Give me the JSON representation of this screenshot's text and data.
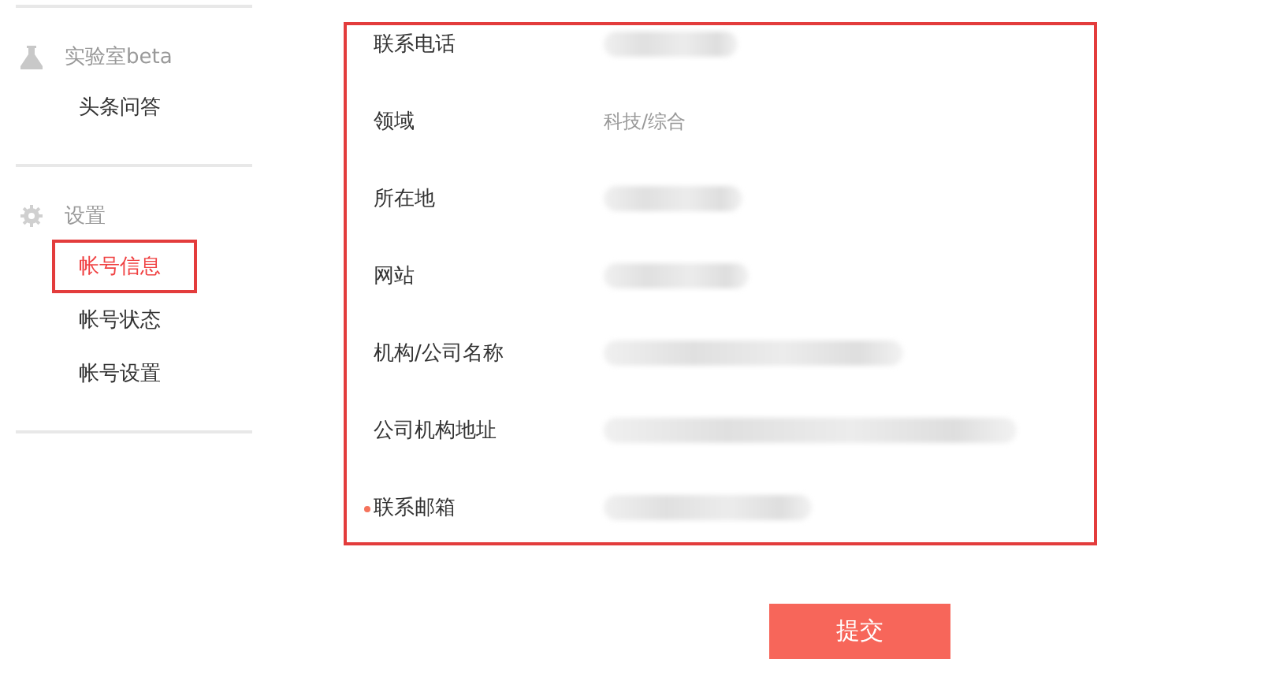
{
  "sidebar": {
    "sections": [
      {
        "kind": "lab",
        "title": "实验室beta",
        "items": [
          {
            "label": "头条问答",
            "selected": false,
            "highlighted": false
          }
        ]
      },
      {
        "kind": "settings",
        "title": "设置",
        "items": [
          {
            "label": "帐号信息",
            "selected": true,
            "highlighted": true
          },
          {
            "label": "帐号状态",
            "selected": false,
            "highlighted": false
          },
          {
            "label": "帐号设置",
            "selected": false,
            "highlighted": false
          }
        ]
      }
    ]
  },
  "form": {
    "highlighted": true,
    "fields": [
      {
        "label": "联系电话",
        "required": false,
        "redacted": true
      },
      {
        "label": "领域",
        "required": false,
        "value": "科技/综合"
      },
      {
        "label": "所在地",
        "required": false,
        "redacted": true
      },
      {
        "label": "网站",
        "required": false,
        "redacted": true
      },
      {
        "label": "机构/公司名称",
        "required": false,
        "redacted": true
      },
      {
        "label": "公司机构地址",
        "required": false,
        "redacted": true
      },
      {
        "label": "联系邮箱",
        "required": true,
        "redacted": true
      }
    ]
  },
  "submit_button": "提交"
}
